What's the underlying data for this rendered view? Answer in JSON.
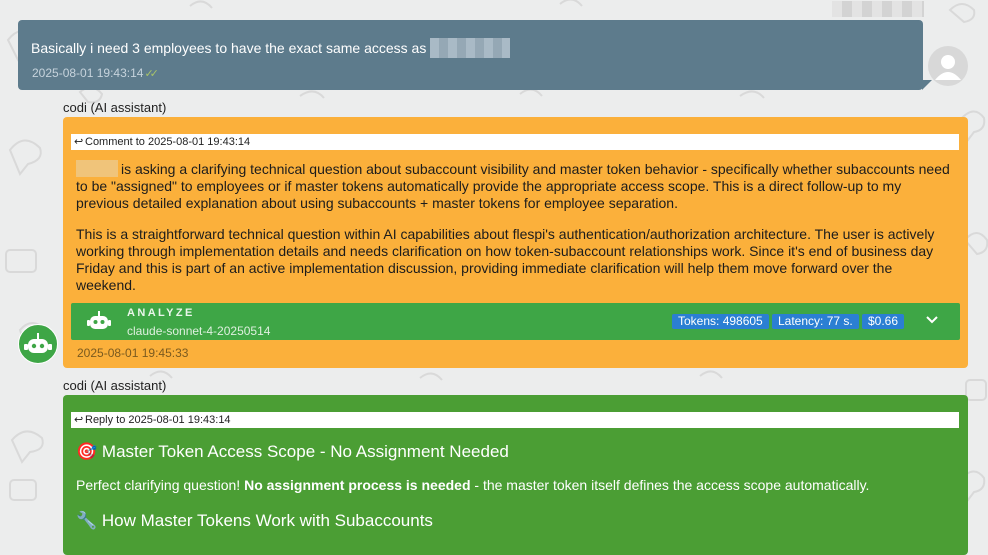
{
  "user_message": {
    "text": "Basically i need 3 employees to have the exact same access as",
    "time": "2025-08-01 19:43:14"
  },
  "orange_message": {
    "sender": "codi (AI assistant)",
    "reply_ref": "Comment to 2025-08-01 19:43:14",
    "paragraph1": "is asking a clarifying technical question about subaccount visibility and master token behavior - specifically whether subaccounts need to be \"assigned\" to employees or if master tokens automatically provide the appropriate access scope. This is a direct follow-up to my previous detailed explanation about using subaccounts + master tokens for employee separation.",
    "paragraph2": "This is a straightforward technical question within AI capabilities about flespi's authentication/authorization architecture. The user is actively working through implementation details and needs clarification on how token-subaccount relationships work. Since it's end of business day Friday and this is part of an active implementation discussion, providing immediate clarification will help them move forward over the weekend.",
    "analyze": {
      "title": "ANALYZE",
      "model": "claude-sonnet-4-20250514",
      "tokens": "Tokens: 498605",
      "latency": "Latency: 77 s.",
      "cost": "$0.66"
    },
    "time": "2025-08-01 19:45:33"
  },
  "green_message": {
    "sender": "codi (AI assistant)",
    "reply_ref": "Reply to 2025-08-01 19:43:14",
    "title_emoji": "🎯",
    "title": "Master Token Access Scope - No Assignment Needed",
    "para_start": "Perfect clarifying question!",
    "para_bold": "No assignment process is needed",
    "para_end": "- the master token itself defines the access scope automatically.",
    "sub_emoji": "🔧",
    "subheading": "How Master Tokens Work with Subaccounts"
  },
  "colors": {
    "user_bubble": "#5d7b8c",
    "orange_bubble": "#fbb03b",
    "green_bubble": "#4b9e34",
    "analyze_bar": "#3ea646",
    "chip": "#2b7fd3"
  }
}
